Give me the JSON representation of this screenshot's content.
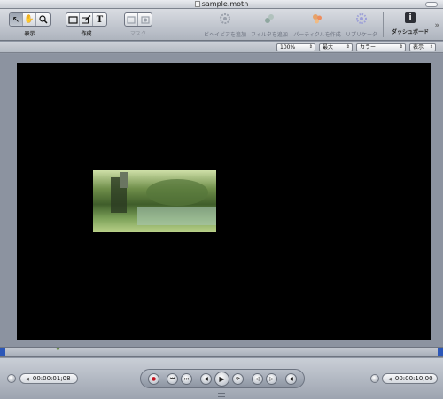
{
  "window": {
    "title": "sample.motn"
  },
  "toolbar": {
    "groups": [
      {
        "label": "表示",
        "tools": [
          {
            "icon": "↖",
            "name": "select-arrow-icon"
          },
          {
            "icon": "✋",
            "name": "pan-hand-icon"
          },
          {
            "icon": "🔍",
            "name": "zoom-icon"
          }
        ]
      },
      {
        "label": "作成",
        "tools": [
          {
            "icon": "▭",
            "name": "rectangle-icon"
          },
          {
            "icon": "✎",
            "name": "pen-icon"
          },
          {
            "icon": "T",
            "name": "text-icon"
          }
        ]
      },
      {
        "label": "マスク",
        "tools": [
          {
            "icon": "▢",
            "name": "mask-rect-icon"
          },
          {
            "icon": "▣",
            "name": "mask-bezier-icon"
          }
        ]
      }
    ],
    "right_tools": [
      {
        "label": "ビヘイビアを追加",
        "icon": "gear-icon",
        "color": "#9aa0ab"
      },
      {
        "label": "フィルタを追加",
        "icon": "filter-icon",
        "color": "#8fa7a0"
      },
      {
        "label": "パーティクルを作成",
        "icon": "particle-icon",
        "color": "#e6a36a"
      },
      {
        "label": "リプリケータ",
        "icon": "replicator-icon",
        "color": "#9c9fd8"
      }
    ],
    "dashboard_label": "ダッシュボード",
    "dashboard_glyph": "i",
    "more_glyph": "»"
  },
  "view_options": {
    "zoom": "100%",
    "resolution": "最大",
    "channels": "カラー",
    "view": "表示"
  },
  "timebar": {
    "playhead_glyph": "Y"
  },
  "transport": {
    "current_time": "00:00:01;08",
    "end_time": "00:00:10;00",
    "buttons": [
      {
        "glyph": "●",
        "name": "record-button"
      },
      {
        "glyph": "⏮",
        "name": "go-to-start-button"
      },
      {
        "glyph": "⏭",
        "name": "go-to-end-button"
      },
      {
        "glyph": "◀",
        "name": "step-back-button"
      },
      {
        "glyph": "▶",
        "name": "play-button"
      },
      {
        "glyph": "⟳",
        "name": "loop-button"
      },
      {
        "glyph": "◁",
        "name": "previous-frame-button"
      },
      {
        "glyph": "▷",
        "name": "next-frame-button"
      },
      {
        "glyph": "◀",
        "name": "audio-button"
      }
    ]
  }
}
